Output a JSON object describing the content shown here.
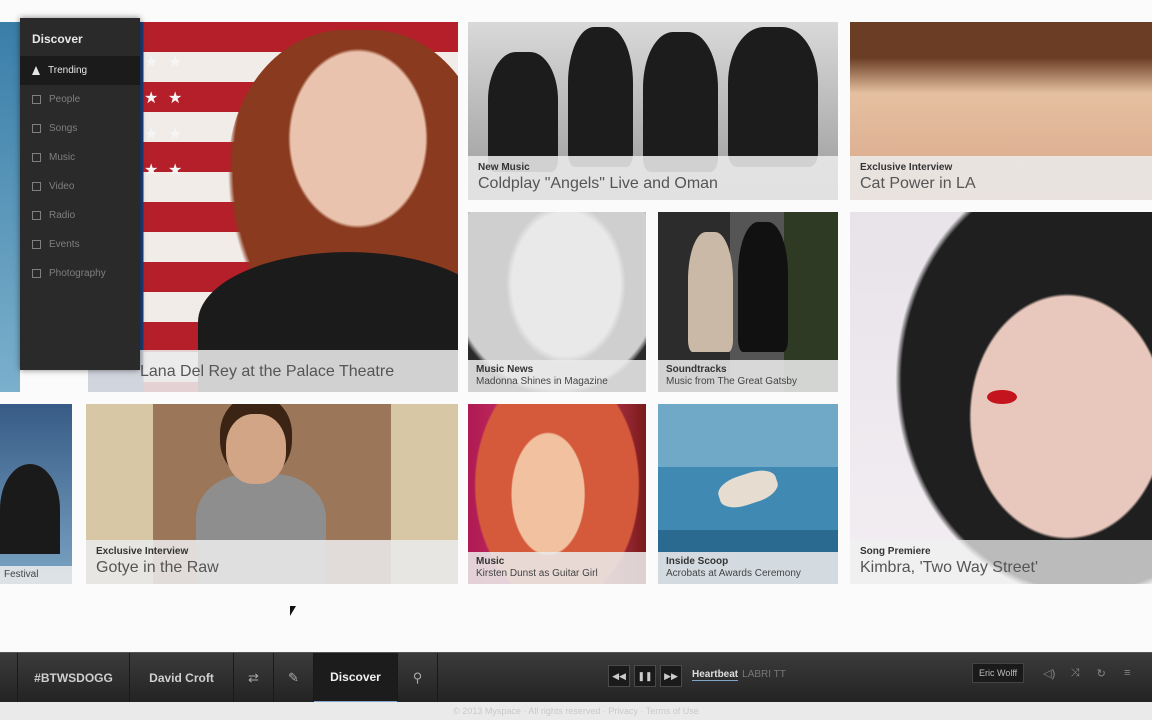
{
  "menu": {
    "title": "Discover",
    "items": [
      {
        "label": "Trending",
        "active": true,
        "icon": "trending-icon"
      },
      {
        "label": "People",
        "icon": "people-icon"
      },
      {
        "label": "Songs",
        "icon": "songs-icon"
      },
      {
        "label": "Music",
        "icon": "music-icon"
      },
      {
        "label": "Video",
        "icon": "video-icon"
      },
      {
        "label": "Radio",
        "icon": "radio-icon"
      },
      {
        "label": "Events",
        "icon": "events-icon"
      },
      {
        "label": "Photography",
        "icon": "photography-icon"
      }
    ]
  },
  "tiles": {
    "lana": {
      "category": "",
      "title": "Lana Del Rey at the Palace Theatre"
    },
    "coldplay": {
      "category": "New Music",
      "title": "Coldplay \"Angels\" Live and Oman"
    },
    "catpower": {
      "category": "Exclusive Interview",
      "title": "Cat Power in LA"
    },
    "madonna": {
      "category": "Music News",
      "title": "Madonna Shines in Magazine"
    },
    "gatsby": {
      "category": "Soundtracks",
      "title": "Music from The Great Gatsby"
    },
    "kimbra": {
      "category": "Song Premiere",
      "title": "Kimbra, 'Two Way Street'"
    },
    "gotye": {
      "category": "Exclusive Interview",
      "title": "Gotye in the Raw"
    },
    "amber": {
      "category": "Music",
      "title": "Kirsten Dunst as Guitar Girl"
    },
    "acro": {
      "category": "Inside Scoop",
      "title": "Acrobats at Awards Ceremony"
    },
    "left": {
      "title": "Festival"
    }
  },
  "bar": {
    "brand": "#BTWSDOGG",
    "user": "David Croft",
    "discover": "Discover",
    "now_playing": "Heartbeat",
    "now_playing_sub": "LABRI TT",
    "right_user": "Eric Wolff"
  },
  "status": "© 2013 Myspace · All rights reserved · Privacy · Terms of Use"
}
